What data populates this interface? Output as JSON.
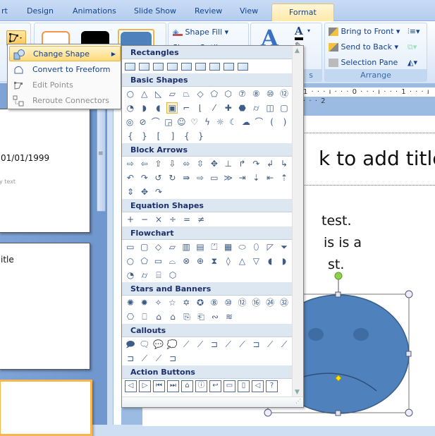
{
  "tabs": [
    {
      "label": "rt",
      "active": false
    },
    {
      "label": "Design",
      "active": false
    },
    {
      "label": "Animations",
      "active": false
    },
    {
      "label": "Slide Show",
      "active": false
    },
    {
      "label": "Review",
      "active": false
    },
    {
      "label": "View",
      "active": false
    },
    {
      "label": "Format",
      "active": true
    }
  ],
  "ribbon": {
    "shape_fill": "Shape Fill",
    "shape_outline": "Shape Outline",
    "wordart_group_label_partial": "s",
    "arrange": {
      "label": "Arrange",
      "bring_to_front": "Bring to Front",
      "send_to_back": "Send to Back",
      "selection_pane": "Selection Pane"
    }
  },
  "ruler": {
    "h_text": "1 · · · ı · · · 0 · · · ı · · · 1 · · · ı · · · 2"
  },
  "context_menu": {
    "items": [
      {
        "label": "Change Shape",
        "highlighted": true,
        "disabled": false,
        "has_submenu": true,
        "icon": "change-shape-icon"
      },
      {
        "label": "Convert to Freeform",
        "highlighted": false,
        "disabled": false,
        "icon": "freeform-icon"
      },
      {
        "label": "Edit Points",
        "highlighted": false,
        "disabled": true,
        "icon": "edit-points-icon"
      },
      {
        "label": "Reroute Connectors",
        "highlighted": false,
        "disabled": true,
        "icon": "reroute-icon"
      }
    ]
  },
  "gallery": {
    "categories": [
      {
        "name": "Rectangles",
        "count": 9
      },
      {
        "name": "Basic Shapes",
        "rows": [
          "○△◺▱⏢◇⬠⬡⑦⑧⑩⑫",
          "◔◗◖▣⌐⌊⁄✚⬣⌭◫▢",
          "◎⊘⌒◲☺♡ϟ☼☾☁⌒()",
          "{} [ ] { }"
        ]
      },
      {
        "name": "Block Arrows",
        "rows": [
          "⇨⇦⇧⇩⬄⇳✥⊥↱↷↲↳",
          "↶↷↺↻⇛⇨▭≫⇥⇣⇤⇡",
          "⇕✥↷"
        ]
      },
      {
        "name": "Equation Shapes",
        "rows": [
          "+−×÷=≠"
        ]
      },
      {
        "name": "Flowchart",
        "rows": [
          "▭▢◇▱▥▤⏍▦⬭⬯◸⏷",
          "○⬠▭⌓⊗⊕⧗◊△▽◖◗",
          "◔⌭⌸⬡"
        ]
      },
      {
        "name": "Stars and Banners",
        "rows": [
          "✺✹✧☆✡✪⑧⑩⑫⑯㉔㉜",
          "⎔⎕⌂⌂⎘⎗∾≋"
        ]
      },
      {
        "name": "Callouts",
        "rows": [
          "🗩🗨💬💭⟋⟋⊐⟋⟋⊐⟋⟋",
          "⊐⟋⟋⊐"
        ]
      },
      {
        "name": "Action Buttons",
        "rows": [
          "◁▷⏮⏭⌂ⓘ↩▭▯◁?"
        ]
      }
    ]
  },
  "slides_panel": {
    "slide1_date": "01/01/1999",
    "slide1_small": "y text",
    "slide2_text": "itle"
  },
  "slide": {
    "title": "k to add title",
    "body_lines": [
      "test.",
      "is is a",
      "st."
    ]
  },
  "colors": {
    "accent": "#15428b",
    "shape_fill": "#4f81bd",
    "highlight": "#ffd97a"
  }
}
